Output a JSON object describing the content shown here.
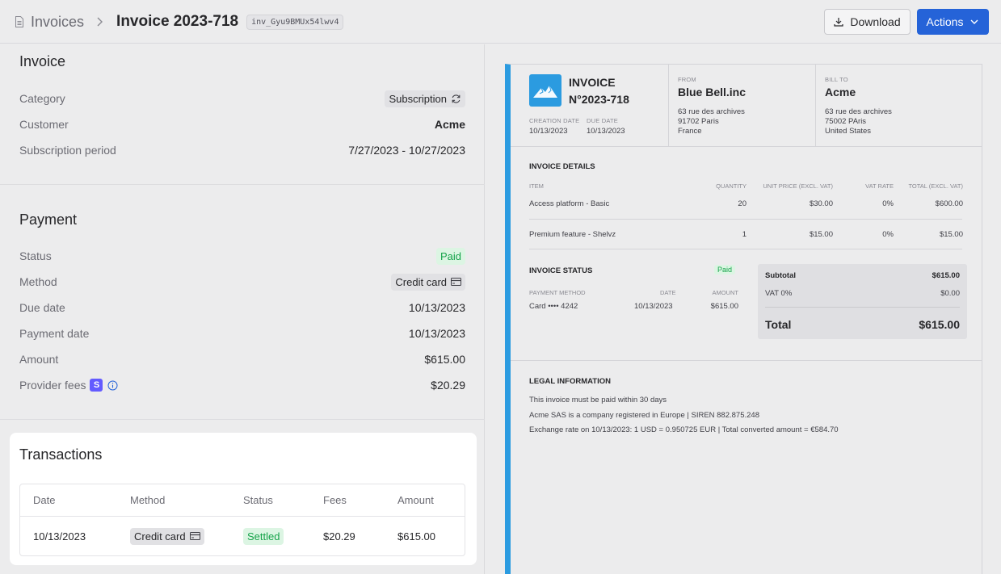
{
  "header": {
    "breadcrumb_root": "Invoices",
    "title": "Invoice 2023-718",
    "invoice_id": "inv_Gyu9BMUx54lwv4",
    "download_label": "Download",
    "actions_label": "Actions"
  },
  "invoice": {
    "section_title": "Invoice",
    "category_label": "Category",
    "category_value": "Subscription",
    "customer_label": "Customer",
    "customer_value": "Acme",
    "period_label": "Subscription period",
    "period_value": "7/27/2023 - 10/27/2023"
  },
  "payment": {
    "section_title": "Payment",
    "status_label": "Status",
    "status_value": "Paid",
    "method_label": "Method",
    "method_value": "Credit card",
    "due_label": "Due date",
    "due_value": "10/13/2023",
    "paydate_label": "Payment date",
    "paydate_value": "10/13/2023",
    "amount_label": "Amount",
    "amount_value": "$615.00",
    "fees_label": "Provider fees",
    "fees_badge": "S",
    "fees_value": "$20.29"
  },
  "transactions": {
    "title": "Transactions",
    "columns": [
      "Date",
      "Method",
      "Status",
      "Fees",
      "Amount"
    ],
    "rows": [
      {
        "date": "10/13/2023",
        "method": "Credit card",
        "status": "Settled",
        "fees": "$20.29",
        "amount": "$615.00"
      }
    ]
  },
  "preview": {
    "title_line1": "INVOICE",
    "title_line2": "N°2023-718",
    "creation_label": "CREATION DATE",
    "creation_value": "10/13/2023",
    "due_label": "DUE DATE",
    "due_value": "10/13/2023",
    "from": {
      "label": "FROM",
      "name": "Blue Bell.inc",
      "line1": "63 rue des archives",
      "line2": "91702 Paris",
      "line3": "France"
    },
    "bill_to": {
      "label": "BILL TO",
      "name": "Acme",
      "line1": "63 rue des archives",
      "line2": "75002 PAris",
      "line3": "United States"
    },
    "details_title": "INVOICE DETAILS",
    "columns": [
      "ITEM",
      "QUANTITY",
      "UNIT PRICE (EXCL. VAT)",
      "VAT RATE",
      "TOTAL (EXCL. VAT)"
    ],
    "items": [
      {
        "item": "Access platform - Basic",
        "qty": "20",
        "unit": "$30.00",
        "vat": "0%",
        "total": "$600.00"
      },
      {
        "item": "Premium feature - Shelvz",
        "qty": "1",
        "unit": "$15.00",
        "vat": "0%",
        "total": "$15.00"
      }
    ],
    "status_title": "INVOICE STATUS",
    "status_value": "Paid",
    "pay_columns": [
      "PAYMENT METHOD",
      "DATE",
      "AMOUNT"
    ],
    "pay_row": {
      "method": "Card •••• 4242",
      "date": "10/13/2023",
      "amount": "$615.00"
    },
    "subtotal_label": "Subtotal",
    "subtotal_value": "$615.00",
    "vat_label": "VAT 0%",
    "vat_value": "$0.00",
    "total_label": "Total",
    "total_value": "$615.00",
    "legal_title": "LEGAL INFORMATION",
    "legal_lines": [
      "This invoice must be paid within 30 days",
      "Acme SAS is a company registered in Europe | SIREN 882.875.248",
      "Exchange rate on 10/13/2023: 1 USD = 0.950725 EUR | Total converted amount = €584.70"
    ]
  },
  "colors": {
    "accent": "#2563d8",
    "preview_stripe": "#2b9be0",
    "paid": "#16a34a",
    "stripe": "#635bff"
  }
}
